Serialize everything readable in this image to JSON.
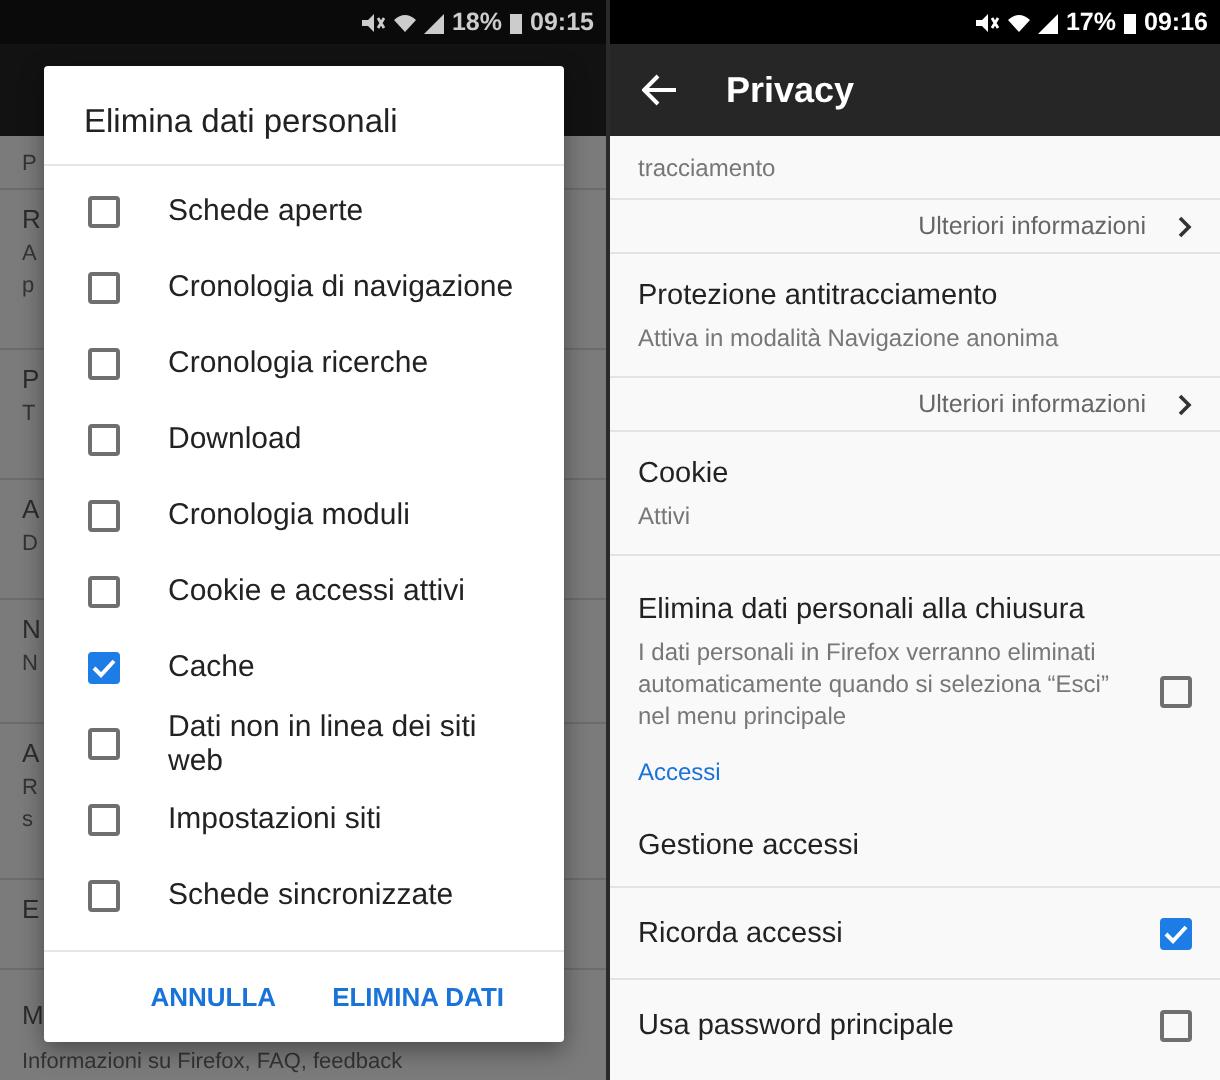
{
  "left_screen": {
    "status_bar": {
      "battery": "18%",
      "time": "09:15"
    },
    "background_rows": [
      {
        "subtitle": [
          "P"
        ]
      },
      {
        "title": "R",
        "subtitle": [
          "A",
          "p"
        ]
      },
      {
        "title": "P",
        "subtitle": [
          "T"
        ]
      },
      {
        "title": "A",
        "subtitle": [
          "D"
        ]
      },
      {
        "title": "N",
        "subtitle": [
          "N"
        ]
      },
      {
        "title": "A",
        "subtitle": [
          "R",
          "s"
        ]
      },
      {
        "title": "E"
      },
      {
        "title": "M",
        "subtitle": [
          "Informazioni su Firefox, FAQ, feedback"
        ]
      }
    ],
    "dialog": {
      "title": "Elimina dati personali",
      "options": [
        {
          "label": "Schede aperte",
          "checked": false
        },
        {
          "label": "Cronologia di navigazione",
          "checked": false
        },
        {
          "label": "Cronologia ricerche",
          "checked": false
        },
        {
          "label": "Download",
          "checked": false
        },
        {
          "label": "Cronologia moduli",
          "checked": false
        },
        {
          "label": "Cookie e accessi attivi",
          "checked": false
        },
        {
          "label": "Cache",
          "checked": true
        },
        {
          "label": "Dati non in linea dei siti web",
          "checked": false
        },
        {
          "label": "Impostazioni siti",
          "checked": false
        },
        {
          "label": "Schede sincronizzate",
          "checked": false
        }
      ],
      "buttons": [
        "ANNULLA",
        "ELIMINA DATI"
      ]
    }
  },
  "right_screen": {
    "status_bar": {
      "battery": "17%",
      "time": "09:16"
    },
    "toolbar": {
      "title": "Privacy"
    },
    "items": [
      {
        "kind": "subtitle_only",
        "subtitle": "tracciamento"
      },
      {
        "kind": "link",
        "label": "Ulteriori informazioni"
      },
      {
        "kind": "setting",
        "title": "Protezione antitracciamento",
        "subtitle": "Attiva in modalità Navigazione anonima"
      },
      {
        "kind": "link",
        "label": "Ulteriori informazioni"
      },
      {
        "kind": "setting",
        "title": "Cookie",
        "subtitle": "Attivi"
      },
      {
        "kind": "checkbox",
        "title": "Elimina dati personali alla chiusura",
        "subtitle": "I dati personali in Firefox verranno eliminati automaticamente quando si seleziona “Esci” nel menu principale",
        "checked": false
      },
      {
        "kind": "header",
        "title": "Accessi"
      },
      {
        "kind": "setting",
        "title": "Gestione accessi"
      },
      {
        "kind": "checkbox",
        "title": "Ricorda accessi",
        "checked": true
      },
      {
        "kind": "checkbox",
        "title": "Usa password principale",
        "checked": false
      }
    ]
  }
}
